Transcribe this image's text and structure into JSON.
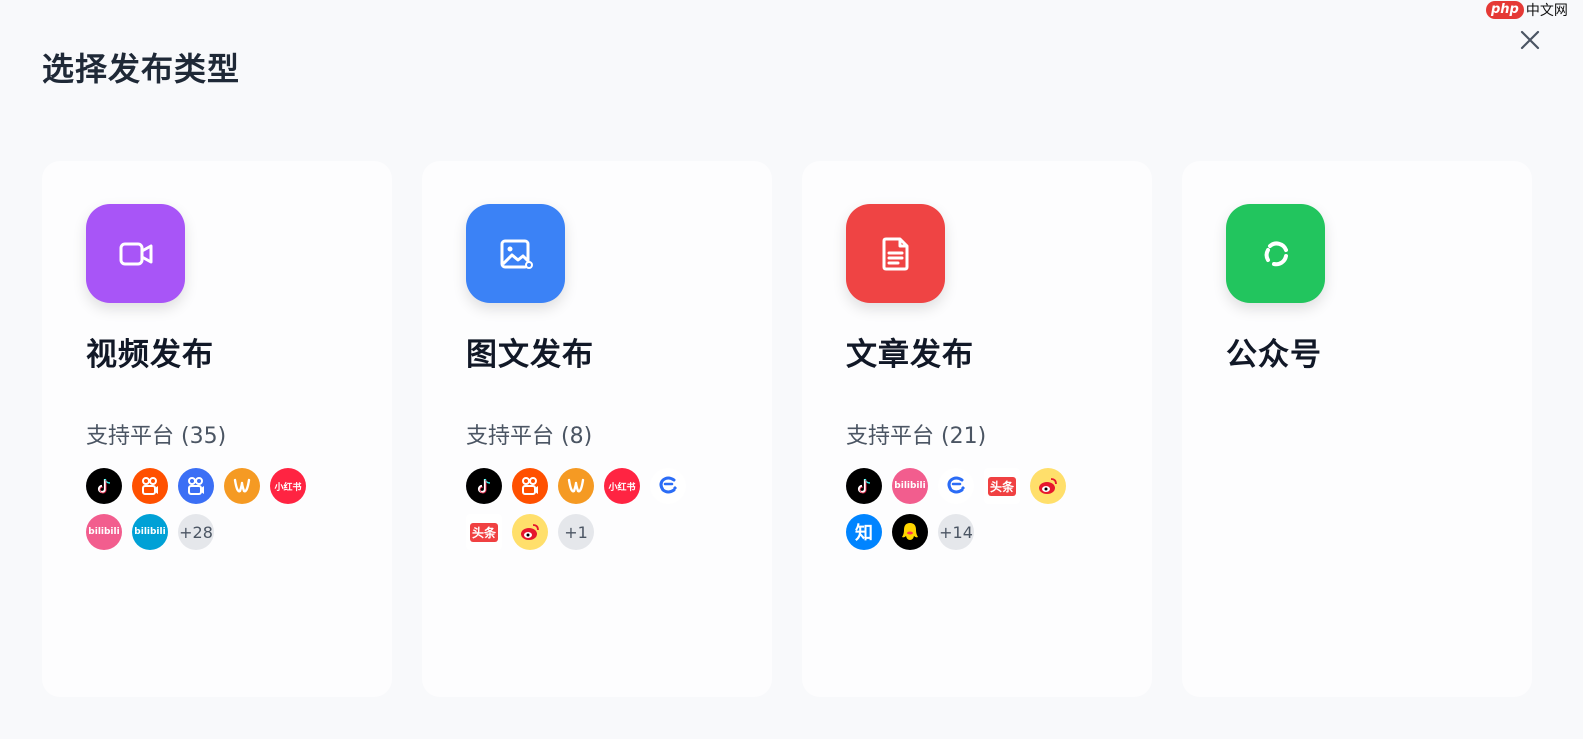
{
  "dialog": {
    "title": "选择发布类型"
  },
  "watermark": {
    "brand": "php",
    "text": "中文网"
  },
  "cards": [
    {
      "title": "视频发布",
      "icon": "video-camera-icon",
      "color": "#a855f7",
      "platform_label": "支持平台 (35)",
      "platforms": [
        {
          "name": "douyin",
          "color": "#000000"
        },
        {
          "name": "kuaishou",
          "color": "#ff5000"
        },
        {
          "name": "kuaishou-blue",
          "color": "#3b6ff5"
        },
        {
          "name": "weishi",
          "color": "#f59a23"
        },
        {
          "name": "xiaohongshu",
          "color": "#ff2442",
          "text": "小红书"
        },
        {
          "name": "bilibili-pink",
          "color": "#f25d8e",
          "text": "bilibili"
        },
        {
          "name": "bilibili-blue",
          "color": "#00a1d6",
          "text": "bilibili"
        }
      ],
      "more": "+28"
    },
    {
      "title": "图文发布",
      "icon": "image-icon",
      "color": "#3b82f6",
      "platform_label": "支持平台 (8)",
      "platforms": [
        {
          "name": "douyin",
          "color": "#000000"
        },
        {
          "name": "kuaishou",
          "color": "#ff5000"
        },
        {
          "name": "weishi",
          "color": "#f59a23"
        },
        {
          "name": "xiaohongshu",
          "color": "#ff2442",
          "text": "小红书"
        },
        {
          "name": "zhihu-c",
          "color": "#ffffff"
        },
        {
          "name": "toutiao",
          "color": "#ffffff",
          "text": "头条"
        },
        {
          "name": "weibo",
          "color": "#ffdf6b"
        }
      ],
      "more": "+1"
    },
    {
      "title": "文章发布",
      "icon": "document-icon",
      "color": "#ef4444",
      "platform_label": "支持平台 (21)",
      "platforms": [
        {
          "name": "douyin",
          "color": "#000000"
        },
        {
          "name": "bilibili-pink",
          "color": "#f25d8e",
          "text": "bilibili"
        },
        {
          "name": "zhihu-c",
          "color": "#ffffff"
        },
        {
          "name": "toutiao",
          "color": "#ffffff",
          "text": "头条"
        },
        {
          "name": "weibo",
          "color": "#ffdf6b"
        },
        {
          "name": "zhihu",
          "color": "#0084ff",
          "text": "知"
        },
        {
          "name": "qq",
          "color": "#000000"
        }
      ],
      "more": "+14"
    },
    {
      "title": "公众号",
      "icon": "wechat-official-icon",
      "color": "#22c55e",
      "platform_label": "",
      "platforms": [],
      "more": ""
    }
  ]
}
